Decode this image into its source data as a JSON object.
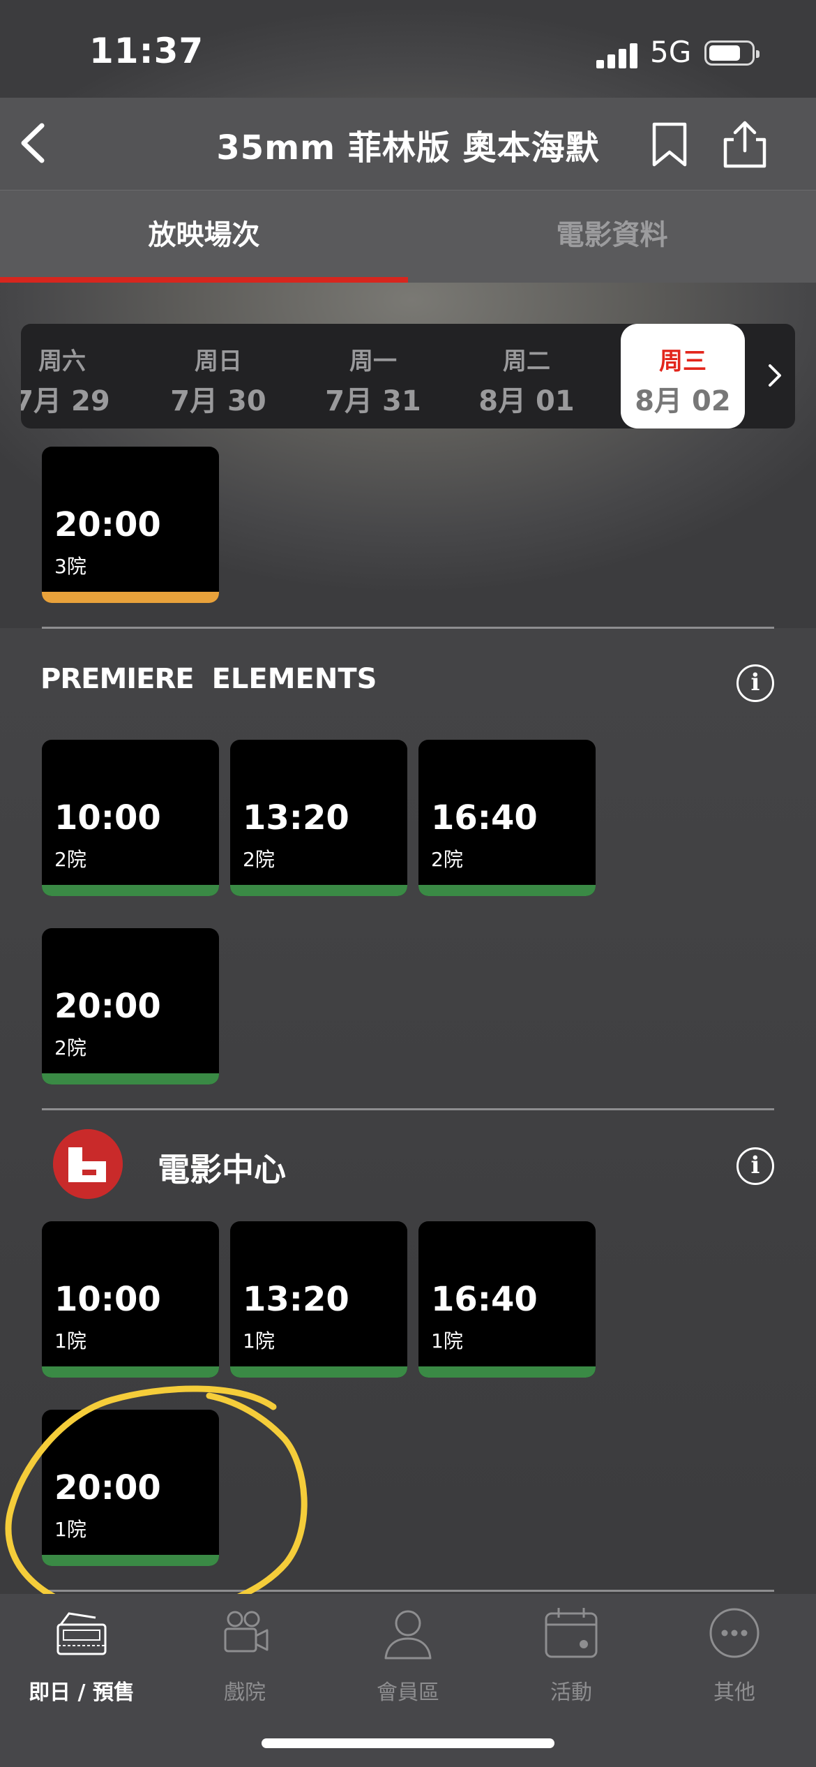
{
  "status_bar": {
    "time": "11:37",
    "network": "5G",
    "battery_level": 0.75
  },
  "header": {
    "title": "35mm 菲林版 奧本海默"
  },
  "tabs": [
    {
      "label": "放映場次",
      "active": true
    },
    {
      "label": "電影資料",
      "active": false
    }
  ],
  "dates": [
    {
      "dow": "周六",
      "date": "7月 29"
    },
    {
      "dow": "周日",
      "date": "7月 30"
    },
    {
      "dow": "周一",
      "date": "7月 31"
    },
    {
      "dow": "周二",
      "date": "8月 01"
    },
    {
      "dow": "周三",
      "date": "8月 02",
      "selected": true
    }
  ],
  "sections": [
    {
      "cinema": "",
      "showtimes": [
        {
          "time": "20:00",
          "hall": "3院",
          "status": "orange"
        }
      ]
    },
    {
      "cinema": "PREMIERE ELEMENTS",
      "logo_text": [
        "PREMIERE",
        "ELEMENTS"
      ],
      "showtimes": [
        {
          "time": "10:00",
          "hall": "2院",
          "status": "green"
        },
        {
          "time": "13:20",
          "hall": "2院",
          "status": "green"
        },
        {
          "time": "16:40",
          "hall": "2院",
          "status": "green"
        },
        {
          "time": "20:00",
          "hall": "2院",
          "status": "green"
        }
      ]
    },
    {
      "cinema": "電影中心",
      "showtimes": [
        {
          "time": "10:00",
          "hall": "1院",
          "status": "green"
        },
        {
          "time": "13:20",
          "hall": "1院",
          "status": "green"
        },
        {
          "time": "16:40",
          "hall": "1院",
          "status": "green"
        },
        {
          "time": "20:00",
          "hall": "1院",
          "status": "green"
        }
      ]
    }
  ],
  "colors": {
    "accent_red": "#d7261e",
    "status_orange": "#e9a23b",
    "status_green": "#3a8a45",
    "annotation_yellow": "#f5cd3a"
  },
  "tab_bar": [
    {
      "label": "即日 / 預售",
      "icon": "ticket-icon",
      "active": true
    },
    {
      "label": "戲院",
      "icon": "camera-icon",
      "active": false
    },
    {
      "label": "會員區",
      "icon": "person-icon",
      "active": false
    },
    {
      "label": "活動",
      "icon": "calendar-icon",
      "active": false
    },
    {
      "label": "其他",
      "icon": "more-icon",
      "active": false
    }
  ]
}
